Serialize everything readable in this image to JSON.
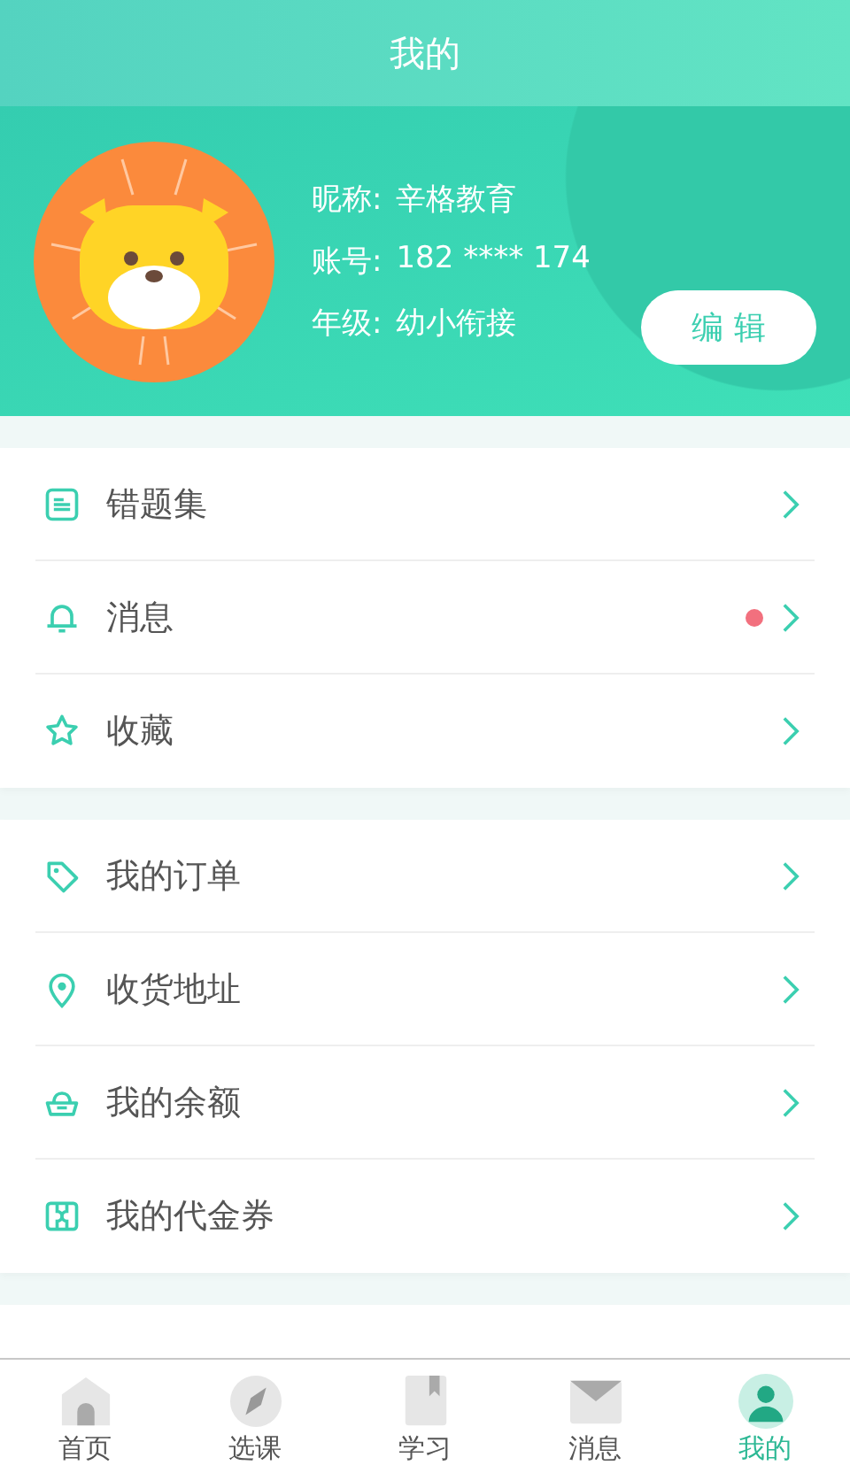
{
  "title": "我的",
  "profile": {
    "nickname_label": "昵称:",
    "nickname": "辛格教育",
    "account_label": "账号:",
    "account": "182 **** 174",
    "grade_label": "年级:",
    "grade": "幼小衔接"
  },
  "edit_button": "编 辑",
  "menu_groups": [
    {
      "items": [
        {
          "label": "错题集",
          "unread": false
        },
        {
          "label": "消息",
          "unread": true
        },
        {
          "label": "收藏",
          "unread": false
        }
      ]
    },
    {
      "items": [
        {
          "label": "我的订单",
          "unread": false
        },
        {
          "label": "收货地址",
          "unread": false
        },
        {
          "label": "我的余额",
          "unread": false
        },
        {
          "label": "我的代金券",
          "unread": false
        }
      ]
    }
  ],
  "tabs": [
    {
      "label": "首页",
      "selected": false
    },
    {
      "label": "选课",
      "selected": false
    },
    {
      "label": "学习",
      "selected": false
    },
    {
      "label": "消息",
      "selected": false
    },
    {
      "label": "我的",
      "selected": true
    }
  ]
}
